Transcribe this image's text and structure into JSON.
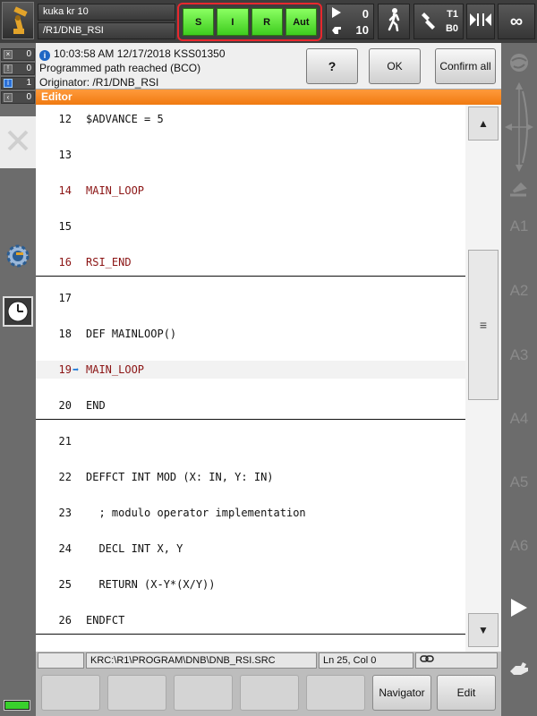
{
  "topbar": {
    "robot_name": "kuka kr 10",
    "program_path": "/R1/DNB_RSI",
    "status_buttons": [
      "S",
      "I",
      "R",
      "Aut"
    ],
    "status_color": "#4fe02a",
    "override_program": "0",
    "override_jog": "10",
    "tool_label": "T1",
    "base_label": "B0",
    "increment": "∞"
  },
  "left_counters": [
    {
      "icon": "x-icon",
      "value": "0"
    },
    {
      "icon": "stop-icon",
      "value": "0"
    },
    {
      "icon": "info-icon",
      "value": "1"
    },
    {
      "icon": "wait-icon",
      "value": "0"
    }
  ],
  "message": {
    "line1": "10:03:58 AM 12/17/2018 KSS01350",
    "line2": "Programmed path reached (BCO)",
    "line3": "Originator: /R1/DNB_RSI",
    "help_label": "?",
    "ok_label": "OK",
    "confirm_all_label": "Confirm all"
  },
  "editor": {
    "title": "Editor",
    "lines": [
      {
        "num": "12",
        "code": "$ADVANCE = 5",
        "kw": false
      },
      {
        "num": "13",
        "code": "",
        "kw": false
      },
      {
        "num": "14",
        "code": "MAIN_LOOP",
        "kw": true
      },
      {
        "num": "15",
        "code": "",
        "kw": false
      },
      {
        "num": "16",
        "code": "RSI_END",
        "kw": true
      },
      {
        "num": "17",
        "code": "",
        "kw": false
      },
      {
        "num": "18",
        "code": "DEF MAINLOOP()",
        "kw": false
      },
      {
        "num": "19",
        "code": "MAIN_LOOP",
        "kw": true,
        "current": true
      },
      {
        "num": "20",
        "code": "END",
        "kw": false
      },
      {
        "num": "21",
        "code": "",
        "kw": false
      },
      {
        "num": "22",
        "code": "DEFFCT INT MOD (X: IN, Y: IN)",
        "kw": false
      },
      {
        "num": "23",
        "code": "  ; modulo operator implementation",
        "kw": false
      },
      {
        "num": "24",
        "code": "  DECL INT X, Y",
        "kw": false
      },
      {
        "num": "25",
        "code": "  RETURN (X-Y*(X/Y))",
        "kw": false
      },
      {
        "num": "26",
        "code": "ENDFCT",
        "kw": false
      }
    ],
    "current_line_arrow": "➡"
  },
  "statusline": {
    "file_path": "KRC:\\R1\\PROGRAM\\DNB\\DNB_RSI.SRC",
    "cursor_pos": "Ln 25, Col 0"
  },
  "bottom": {
    "navigator_label": "Navigator",
    "edit_label": "Edit"
  },
  "right_axes": [
    "A1",
    "A2",
    "A3",
    "A4",
    "A5",
    "A6"
  ],
  "colors": {
    "editor_header": "#f07a10",
    "keyword": "#8b1414",
    "highlight_border": "#e8282e"
  }
}
